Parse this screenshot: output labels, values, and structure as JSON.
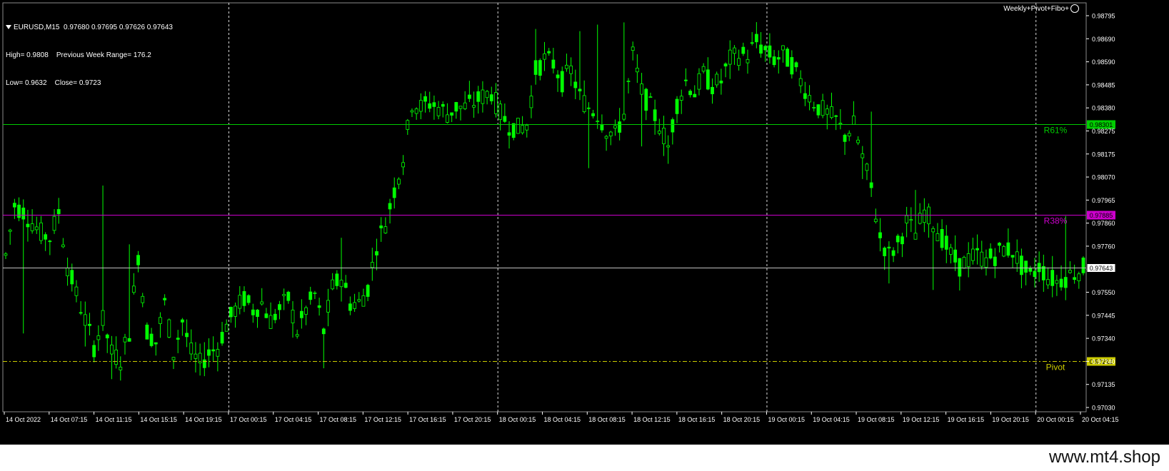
{
  "chart_header": {
    "symbol_line": "EURUSD,M15  0.97680 0.97695 0.97626 0.97643",
    "high_line": "High= 0.9808    Previous Week Range= 176.2",
    "low_line": "Low= 0.9632    Close= 0.9723"
  },
  "indicator_label": "Weekly+Pivot+Fibo+",
  "watermark": "www.mt4.shop",
  "colors": {
    "background": "#000000",
    "candles": "#00FF00",
    "r61": "#00CC00",
    "r38": "#CC00CC",
    "pivot": "#CCCC00",
    "current": "#C0C0C0"
  },
  "levels": [
    {
      "name": "R61%",
      "price": 0.98301,
      "price_label": "0.98301",
      "color": "#00CC00",
      "style": "solid"
    },
    {
      "name": "R38%",
      "price": 0.97885,
      "price_label": "0.97885",
      "color": "#CC00CC",
      "style": "solid"
    },
    {
      "name": "Pivot",
      "price": 0.97212,
      "price_label": "0.97212",
      "color": "#CCCC00",
      "style": "dashdot"
    }
  ],
  "current_price": {
    "price": 0.97643,
    "label": "0.97643"
  },
  "chart_data": {
    "type": "candlestick",
    "y_ticks": [
      "0.98795",
      "0.98690",
      "0.98590",
      "0.98485",
      "0.98380",
      "0.98275",
      "0.98175",
      "0.98070",
      "0.97965",
      "0.97860",
      "0.97760",
      "0.97655",
      "0.97550",
      "0.97445",
      "0.97340",
      "0.97240",
      "0.97135",
      "0.97030"
    ],
    "ylim": [
      0.9698,
      0.9886
    ],
    "x_ticks": [
      "14 Oct 2022",
      "14 Oct 07:15",
      "14 Oct 11:15",
      "14 Oct 15:15",
      "14 Oct 19:15",
      "17 Oct 00:15",
      "17 Oct 04:15",
      "17 Oct 08:15",
      "17 Oct 12:15",
      "17 Oct 16:15",
      "17 Oct 20:15",
      "18 Oct 00:15",
      "18 Oct 04:15",
      "18 Oct 08:15",
      "18 Oct 12:15",
      "18 Oct 16:15",
      "18 Oct 20:15",
      "19 Oct 00:15",
      "19 Oct 04:15",
      "19 Oct 08:15",
      "19 Oct 12:15",
      "19 Oct 16:15",
      "19 Oct 20:15",
      "20 Oct 00:15",
      "20 Oct 04:15"
    ],
    "session_separators": [
      "17 Oct 00:15",
      "18 Oct 00:15",
      "19 Oct 00:15",
      "20 Oct 00:15"
    ],
    "path": [
      [
        0,
        0.977
      ],
      [
        2,
        0.9793
      ],
      [
        4,
        0.979
      ],
      [
        6,
        0.9785
      ],
      [
        8,
        0.978
      ],
      [
        10,
        0.9778
      ],
      [
        12,
        0.979
      ],
      [
        14,
        0.9765
      ],
      [
        16,
        0.9752
      ],
      [
        18,
        0.974
      ],
      [
        20,
        0.9728
      ],
      [
        22,
        0.974
      ],
      [
        24,
        0.9725
      ],
      [
        26,
        0.9722
      ],
      [
        28,
        0.9735
      ],
      [
        30,
        0.977
      ],
      [
        32,
        0.9735
      ],
      [
        34,
        0.973
      ],
      [
        36,
        0.9748
      ],
      [
        38,
        0.9725
      ],
      [
        40,
        0.974
      ],
      [
        42,
        0.9725
      ],
      [
        44,
        0.972
      ],
      [
        46,
        0.9725
      ],
      [
        48,
        0.9728
      ],
      [
        50,
        0.9738
      ],
      [
        52,
        0.9745
      ],
      [
        54,
        0.975
      ],
      [
        56,
        0.9745
      ],
      [
        58,
        0.9748
      ],
      [
        60,
        0.974
      ],
      [
        62,
        0.9745
      ],
      [
        64,
        0.975
      ],
      [
        66,
        0.9735
      ],
      [
        68,
        0.9745
      ],
      [
        70,
        0.9752
      ],
      [
        72,
        0.9735
      ],
      [
        74,
        0.9755
      ],
      [
        76,
        0.976
      ],
      [
        78,
        0.9748
      ],
      [
        80,
        0.9748
      ],
      [
        82,
        0.9755
      ],
      [
        84,
        0.9775
      ],
      [
        86,
        0.9785
      ],
      [
        88,
        0.98
      ],
      [
        90,
        0.9815
      ],
      [
        92,
        0.984
      ],
      [
        94,
        0.9838
      ],
      [
        96,
        0.984
      ],
      [
        98,
        0.9838
      ],
      [
        100,
        0.9835
      ],
      [
        102,
        0.9838
      ],
      [
        104,
        0.9838
      ],
      [
        106,
        0.984
      ],
      [
        108,
        0.9843
      ],
      [
        110,
        0.9845
      ],
      [
        112,
        0.9835
      ],
      [
        114,
        0.983
      ],
      [
        116,
        0.9828
      ],
      [
        118,
        0.983
      ],
      [
        120,
        0.9855
      ],
      [
        122,
        0.986
      ],
      [
        124,
        0.9858
      ],
      [
        126,
        0.985
      ],
      [
        128,
        0.9855
      ],
      [
        130,
        0.9843
      ],
      [
        132,
        0.9838
      ],
      [
        134,
        0.9835
      ],
      [
        136,
        0.9828
      ],
      [
        138,
        0.9825
      ],
      [
        140,
        0.9835
      ],
      [
        142,
        0.9862
      ],
      [
        144,
        0.9845
      ],
      [
        146,
        0.9838
      ],
      [
        148,
        0.983
      ],
      [
        150,
        0.982
      ],
      [
        152,
        0.984
      ],
      [
        154,
        0.985
      ],
      [
        156,
        0.9845
      ],
      [
        158,
        0.9853
      ],
      [
        160,
        0.9848
      ],
      [
        162,
        0.985
      ],
      [
        164,
        0.986
      ],
      [
        166,
        0.9862
      ],
      [
        168,
        0.9862
      ],
      [
        170,
        0.9868
      ],
      [
        172,
        0.9864
      ],
      [
        174,
        0.986
      ],
      [
        176,
        0.9862
      ],
      [
        178,
        0.9858
      ],
      [
        180,
        0.985
      ],
      [
        182,
        0.9843
      ],
      [
        184,
        0.9838
      ],
      [
        186,
        0.9835
      ],
      [
        188,
        0.9832
      ],
      [
        190,
        0.9825
      ],
      [
        192,
        0.983
      ],
      [
        194,
        0.9815
      ],
      [
        196,
        0.98
      ],
      [
        198,
        0.9778
      ],
      [
        200,
        0.977
      ],
      [
        202,
        0.9775
      ],
      [
        204,
        0.9785
      ],
      [
        206,
        0.978
      ],
      [
        208,
        0.979
      ],
      [
        210,
        0.9785
      ],
      [
        212,
        0.9778
      ],
      [
        214,
        0.977
      ],
      [
        216,
        0.9765
      ],
      [
        218,
        0.9768
      ],
      [
        220,
        0.977
      ],
      [
        222,
        0.9768
      ],
      [
        224,
        0.977
      ],
      [
        226,
        0.9773
      ],
      [
        228,
        0.9772
      ],
      [
        230,
        0.9765
      ],
      [
        232,
        0.976
      ],
      [
        234,
        0.9765
      ],
      [
        236,
        0.976
      ],
      [
        238,
        0.9758
      ],
      [
        240,
        0.976
      ],
      [
        242,
        0.9762
      ],
      [
        244,
        0.9764
      ]
    ],
    "spikes": [
      [
        4,
        0.9734
      ],
      [
        18,
        0.9728
      ],
      [
        22,
        0.9802
      ],
      [
        24,
        0.9713
      ],
      [
        26,
        0.9715
      ],
      [
        28,
        0.9775
      ],
      [
        38,
        0.9718
      ],
      [
        45,
        0.973
      ],
      [
        72,
        0.9718
      ],
      [
        76,
        0.9778
      ],
      [
        120,
        0.9874
      ],
      [
        122,
        0.9868
      ],
      [
        130,
        0.9873
      ],
      [
        132,
        0.981
      ],
      [
        134,
        0.9876
      ],
      [
        136,
        0.9818
      ],
      [
        140,
        0.9877
      ],
      [
        144,
        0.982
      ],
      [
        150,
        0.9812
      ],
      [
        170,
        0.9872
      ],
      [
        194,
        0.9805
      ],
      [
        196,
        0.9836
      ],
      [
        200,
        0.9757
      ],
      [
        206,
        0.98
      ],
      [
        210,
        0.9754
      ],
      [
        240,
        0.9788
      ]
    ],
    "bars": 245
  }
}
